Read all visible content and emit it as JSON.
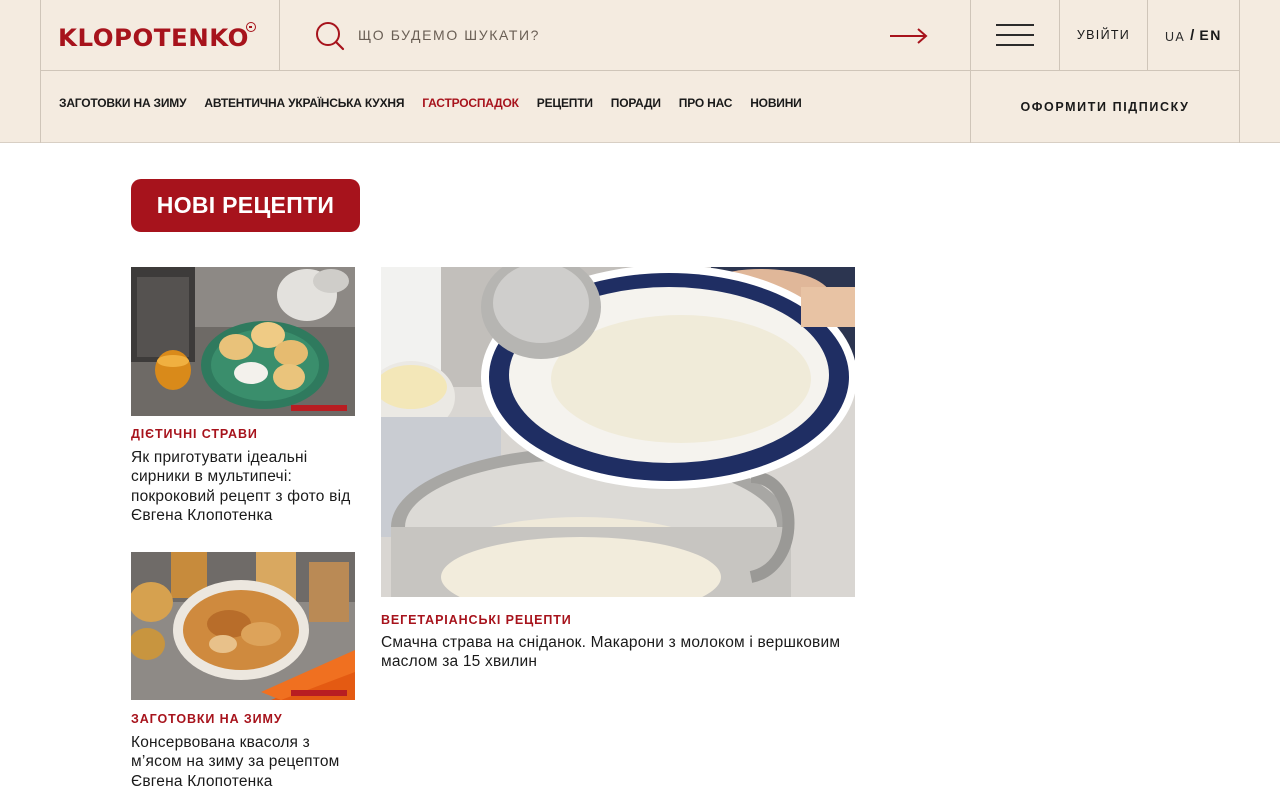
{
  "brand": {
    "logo_text": "KLOPOTENKO",
    "accent_color": "#a7131c",
    "header_bg": "#f4ebe0"
  },
  "header": {
    "search": {
      "placeholder": "ЩО БУДЕМО ШУКАТИ?",
      "value": ""
    },
    "login_label": "УВІЙТИ",
    "lang": {
      "ua": "UA",
      "separator": "/",
      "en": "EN"
    },
    "subscribe_label": "ОФОРМИТИ ПІДПИСКУ",
    "icons": {
      "search": "search-icon",
      "submit": "arrow-right-icon",
      "menu": "hamburger-menu-icon"
    }
  },
  "nav": {
    "items": [
      {
        "label": "ЗАГОТОВКИ НА ЗИМУ"
      },
      {
        "label": "АВТЕНТИЧНА УКРАЇНСЬКА КУХНЯ"
      },
      {
        "label": "ГАСТРОСПАДОК",
        "active": true
      },
      {
        "label": "РЕЦЕПТИ"
      },
      {
        "label": "ПОРАДИ"
      },
      {
        "label": "ПРО НАС"
      },
      {
        "label": "НОВИНИ"
      }
    ]
  },
  "main": {
    "section_label": "НОВІ РЕЦЕПТИ",
    "cards": [
      {
        "category": "ДІЄТИЧНІ СТРАВИ",
        "title": "Як приготувати ідеальні сирники в мультипечі: покроковий рецепт з фото від Євгена Клопотенка",
        "image": "syrnyky-photo"
      },
      {
        "category": "ЗАГОТОВКИ НА ЗИМУ",
        "title": "Консервована квасоля з м’ясом на зиму за рецептом Євгена Клопотенка",
        "image": "beans-with-meat-photo"
      },
      {
        "category": "ВЕГЕТАРІАНСЬКІ РЕЦЕПТИ",
        "title": "Смачна страва на сніданок. Макарони з молоком і вершковим маслом за 15 хвилин",
        "image": "pasta-with-milk-photo"
      }
    ]
  }
}
